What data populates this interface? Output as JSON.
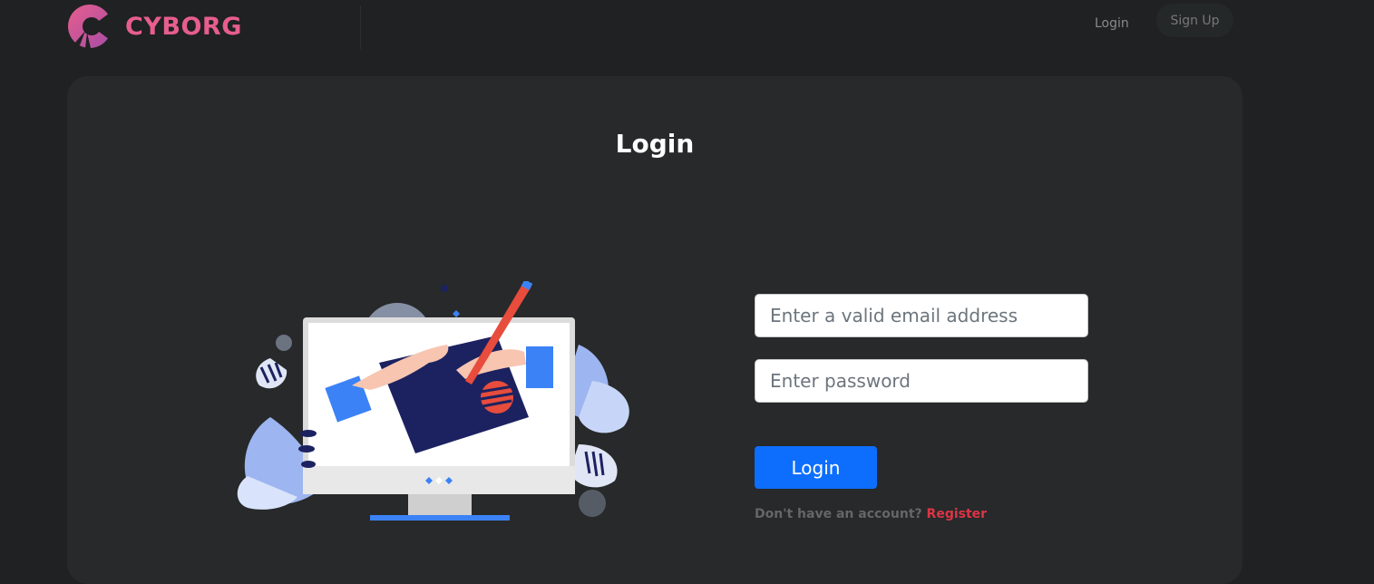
{
  "header": {
    "brand": "CYBORG",
    "nav": {
      "login": "Login",
      "signup": "Sign Up"
    }
  },
  "main": {
    "title": "Login",
    "form": {
      "email_placeholder": "Enter a valid email address",
      "email_value": "",
      "password_placeholder": "Enter password",
      "password_value": "",
      "submit_label": "Login",
      "register_prompt": "Don't have an account? ",
      "register_link": "Register"
    }
  },
  "colors": {
    "background": "#1f2122",
    "card": "#27292a",
    "brand": "#e75e8d",
    "primary_button": "#0d6efd",
    "register_link": "#dc3545"
  },
  "icons": {
    "logo": "cyborg-logo-icon",
    "illustration": "computer-drawing-illustration"
  }
}
